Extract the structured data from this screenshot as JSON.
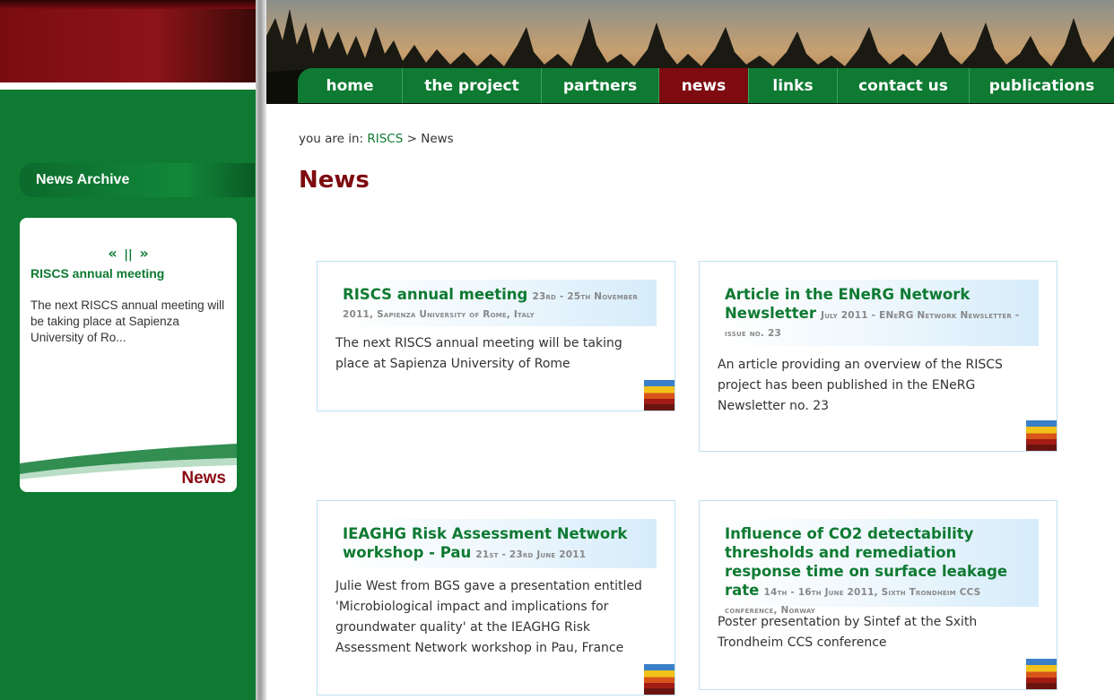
{
  "sidebar": {
    "archive_label": "News Archive",
    "card": {
      "arrow_prev": "«",
      "pause": "||",
      "arrow_next": "»",
      "title": "RISCS annual meeting",
      "text": "The next RISCS annual meeting will be taking place at Sapienza University of Ro...",
      "label": "News"
    }
  },
  "nav": {
    "items": [
      {
        "label": "home"
      },
      {
        "label": "the project"
      },
      {
        "label": "partners"
      },
      {
        "label": "news"
      },
      {
        "label": "links"
      },
      {
        "label": "contact us"
      },
      {
        "label": "publications"
      }
    ],
    "active": "news"
  },
  "breadcrumb": {
    "prefix": "you are in:",
    "link": "RISCS",
    "separator": ">",
    "current": "News"
  },
  "page_title": "News",
  "news": [
    {
      "title": "RISCS annual meeting",
      "meta": "23rd - 25th November 2011, Sapienza University of Rome, Italy",
      "desc": "The next RISCS annual meeting will be taking place at Sapienza University of Rome"
    },
    {
      "title": "Article in the ENeRG Network Newsletter",
      "meta": "July 2011 - ENeRG Network Newsletter - issue no. 23",
      "desc": "An article providing an overview of the RISCS project has been published in the ENeRG Newsletter no. 23"
    },
    {
      "title": "IEAGHG Risk Assessment Network workshop - Pau",
      "meta": "21st - 23rd June 2011",
      "desc": "Julie West from BGS gave a presentation entitled 'Microbiological impact and implications for groundwater quality' at the IEAGHG Risk Assessment Network workshop in Pau, France"
    },
    {
      "title": "Influence of CO2 detectability thresholds and remediation response time on surface leakage rate",
      "meta": "14th - 16th June 2011, Sixth Trondheim CCS conference, Norway",
      "desc": "Poster presentation by Sintef at the Sxith Trondheim CCS conference"
    }
  ],
  "colors": {
    "green": "#0e7a32",
    "maroon": "#7e0b0f",
    "box_border": "#bfe0f0"
  },
  "icons": [
    "stripe-logo-icon",
    "arrow-prev-icon",
    "pause-icon",
    "arrow-next-icon"
  ]
}
